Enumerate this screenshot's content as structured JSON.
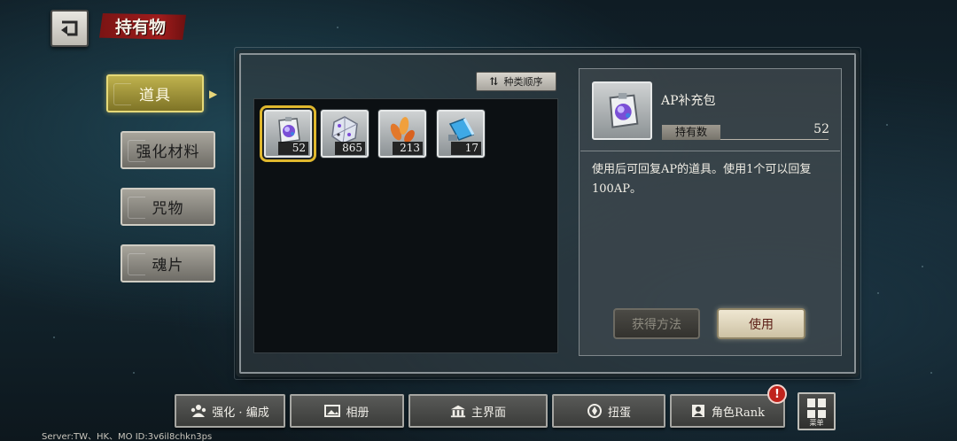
{
  "header": {
    "title": "持有物"
  },
  "categories": [
    {
      "label": "道具",
      "active": true
    },
    {
      "label": "强化材料",
      "active": false
    },
    {
      "label": "咒物",
      "active": false
    },
    {
      "label": "魂片",
      "active": false
    }
  ],
  "sort_label": "种类顺序",
  "items": [
    {
      "icon": "ap-pack-icon",
      "count": "52"
    },
    {
      "icon": "crystal-die-icon",
      "count": "865"
    },
    {
      "icon": "orange-leaves-icon",
      "count": "213"
    },
    {
      "icon": "blue-horn-icon",
      "count": "17"
    }
  ],
  "detail": {
    "name": "AP补充包",
    "own_label": "持有数",
    "own_value": "52",
    "description": "使用后可回复AP的道具。使用1个可以回复100AP。",
    "acquire_label": "获得方法",
    "use_label": "使用"
  },
  "nav": [
    {
      "label": "强化 · 编成",
      "icon": "team-icon"
    },
    {
      "label": "相册",
      "icon": "album-icon"
    },
    {
      "label": "主界面",
      "icon": "home-icon"
    },
    {
      "label": "扭蛋",
      "icon": "gacha-icon"
    },
    {
      "label": "角色Rank",
      "icon": "rank-icon"
    }
  ],
  "alert_badge": "!",
  "menu_label": "菜单",
  "server_info": "Server:TW、HK、MO ID:3v6il8chkn3ps",
  "colors": {
    "active_tab": "#bfb24e",
    "selection": "#e0b82e",
    "badge": "#c0231c"
  }
}
